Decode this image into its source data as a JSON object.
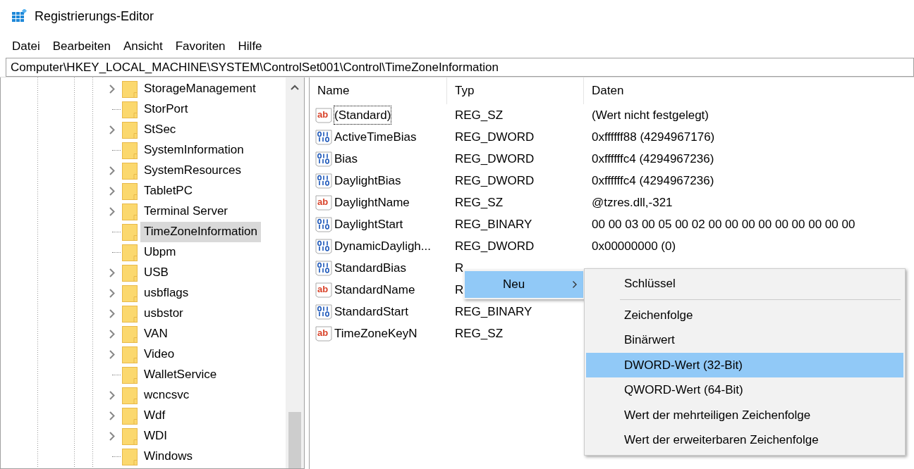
{
  "window": {
    "title": "Registrierungs-Editor"
  },
  "menu_bar": [
    "Datei",
    "Bearbeiten",
    "Ansicht",
    "Favoriten",
    "Hilfe"
  ],
  "address_bar": {
    "value": "Computer\\HKEY_LOCAL_MACHINE\\SYSTEM\\ControlSet001\\Control\\TimeZoneInformation"
  },
  "tree": {
    "items": [
      {
        "label": "StorageManagement",
        "expandable": true,
        "selected": false
      },
      {
        "label": "StorPort",
        "expandable": false,
        "selected": false
      },
      {
        "label": "StSec",
        "expandable": true,
        "selected": false
      },
      {
        "label": "SystemInformation",
        "expandable": false,
        "selected": false
      },
      {
        "label": "SystemResources",
        "expandable": true,
        "selected": false
      },
      {
        "label": "TabletPC",
        "expandable": true,
        "selected": false
      },
      {
        "label": "Terminal Server",
        "expandable": true,
        "selected": false
      },
      {
        "label": "TimeZoneInformation",
        "expandable": false,
        "selected": true
      },
      {
        "label": "Ubpm",
        "expandable": false,
        "selected": false
      },
      {
        "label": "USB",
        "expandable": true,
        "selected": false
      },
      {
        "label": "usbflags",
        "expandable": true,
        "selected": false
      },
      {
        "label": "usbstor",
        "expandable": true,
        "selected": false
      },
      {
        "label": "VAN",
        "expandable": true,
        "selected": false
      },
      {
        "label": "Video",
        "expandable": true,
        "selected": false
      },
      {
        "label": "WalletService",
        "expandable": false,
        "selected": false
      },
      {
        "label": "wcncsvc",
        "expandable": true,
        "selected": false
      },
      {
        "label": "Wdf",
        "expandable": true,
        "selected": false
      },
      {
        "label": "WDI",
        "expandable": true,
        "selected": false
      },
      {
        "label": "Windows",
        "expandable": false,
        "selected": false
      }
    ]
  },
  "values_table": {
    "columns": [
      "Name",
      "Typ",
      "Daten"
    ],
    "rows": [
      {
        "kind": "string",
        "icon": "ab",
        "name": "(Standard)",
        "type": "REG_SZ",
        "data": "(Wert nicht festgelegt)",
        "focused": true
      },
      {
        "kind": "binary",
        "name": "ActiveTimeBias",
        "type": "REG_DWORD",
        "data": "0xffffff88 (4294967176)",
        "focused": false
      },
      {
        "kind": "binary",
        "name": "Bias",
        "type": "REG_DWORD",
        "data": "0xffffffc4 (4294967236)",
        "focused": false
      },
      {
        "kind": "binary",
        "name": "DaylightBias",
        "type": "REG_DWORD",
        "data": "0xffffffc4 (4294967236)",
        "focused": false
      },
      {
        "kind": "string",
        "icon": "ab",
        "name": "DaylightName",
        "type": "REG_SZ",
        "data": "@tzres.dll,-321",
        "focused": false
      },
      {
        "kind": "binary",
        "name": "DaylightStart",
        "type": "REG_BINARY",
        "data": "00 00 03 00 05 00 02 00 00 00 00 00 00 00 00 00",
        "focused": false
      },
      {
        "kind": "binary",
        "name": "DynamicDayligh...",
        "type": "REG_DWORD",
        "data": "0x00000000 (0)",
        "focused": false
      },
      {
        "kind": "binary",
        "name": "StandardBias",
        "type": "R",
        "focused": false
      },
      {
        "kind": "string",
        "icon": "ab",
        "name": "StandardName",
        "type": "R",
        "focused": false
      },
      {
        "kind": "binary",
        "name": "StandardStart",
        "type": "REG_BINARY",
        "focused": false
      },
      {
        "kind": "string",
        "icon": "ab",
        "name": "TimeZoneKeyN",
        "type": "REG_SZ",
        "focused": false
      }
    ]
  },
  "context_menu": {
    "items": [
      {
        "label": "Neu",
        "selected": true,
        "submenu": true
      }
    ]
  },
  "submenu": {
    "items": [
      {
        "kind": "item",
        "label": "Schlüssel",
        "selected": false
      },
      {
        "kind": "separator"
      },
      {
        "kind": "item",
        "label": "Zeichenfolge",
        "selected": false
      },
      {
        "kind": "item",
        "label": "Binärwert",
        "selected": false
      },
      {
        "kind": "item",
        "label": "DWORD-Wert (32-Bit)",
        "selected": true
      },
      {
        "kind": "item",
        "label": "QWORD-Wert (64-Bit)",
        "selected": false
      },
      {
        "kind": "item",
        "label": "Wert der mehrteiligen Zeichenfolge",
        "selected": false
      },
      {
        "kind": "item",
        "label": "Wert der erweiterbaren Zeichenfolge",
        "selected": false
      }
    ]
  }
}
